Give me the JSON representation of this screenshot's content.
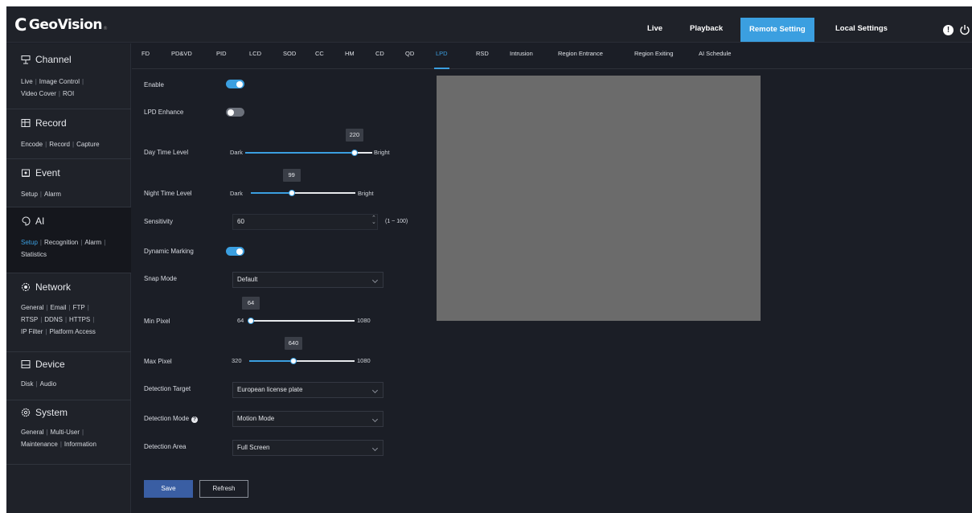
{
  "brand": {
    "name": "GeoVision"
  },
  "topnav": [
    {
      "label": "Live",
      "active": false
    },
    {
      "label": "Playback",
      "active": false
    },
    {
      "label": "Remote Setting",
      "active": true
    },
    {
      "label": "Local Settings",
      "active": false
    }
  ],
  "sidebar": {
    "channel": {
      "title": "Channel",
      "links": [
        "Live",
        "Image Control",
        "Video Cover",
        "ROI"
      ]
    },
    "record": {
      "title": "Record",
      "links": [
        "Encode",
        "Record",
        "Capture"
      ]
    },
    "event": {
      "title": "Event",
      "links": [
        "Setup",
        "Alarm"
      ]
    },
    "ai": {
      "title": "AI",
      "links": [
        "Setup",
        "Recognition",
        "Alarm",
        "Statistics"
      ],
      "active_link": "Setup"
    },
    "network": {
      "title": "Network",
      "links": [
        "General",
        "Email",
        "FTP",
        "RTSP",
        "DDNS",
        "HTTPS",
        "IP Filter",
        "Platform Access"
      ]
    },
    "device": {
      "title": "Device",
      "links": [
        "Disk",
        "Audio"
      ]
    },
    "system": {
      "title": "System",
      "links": [
        "General",
        "Multi-User",
        "Maintenance",
        "Information"
      ]
    }
  },
  "tabs": [
    "FD",
    "PD&VD",
    "PID",
    "LCD",
    "SOD",
    "CC",
    "HM",
    "CD",
    "QD",
    "LPD",
    "RSD",
    "Intrusion",
    "Region Entrance",
    "Region Exiting",
    "AI Schedule"
  ],
  "active_tab": "LPD",
  "form": {
    "enable": {
      "label": "Enable",
      "on": true
    },
    "lpd_enhance": {
      "label": "LPD Enhance",
      "on": false
    },
    "day_time_level": {
      "label": "Day Time Level",
      "min_label": "Dark",
      "max_label": "Bright",
      "value": 220,
      "value_text": "220",
      "fraction": 0.86
    },
    "night_time_level": {
      "label": "Night Time Level",
      "min_label": "Dark",
      "max_label": "Bright",
      "value": 99,
      "value_text": "99",
      "fraction": 0.39
    },
    "sensitivity": {
      "label": "Sensitivity",
      "value": "60",
      "range_hint": "(1 ~ 100)"
    },
    "dynamic_marking": {
      "label": "Dynamic Marking",
      "on": true
    },
    "snap_mode": {
      "label": "Snap Mode",
      "value": "Default"
    },
    "min_pixel": {
      "label": "Min Pixel",
      "min_label": "64",
      "max_label": "1080",
      "value": 64,
      "value_text": "64",
      "fraction": 0.0
    },
    "max_pixel": {
      "label": "Max Pixel",
      "min_label": "320",
      "max_label": "1080",
      "value": 640,
      "value_text": "640",
      "fraction": 0.42
    },
    "detection_target": {
      "label": "Detection Target",
      "value": "European license plate"
    },
    "detection_mode": {
      "label": "Detection Mode",
      "value": "Motion Mode"
    },
    "detection_area": {
      "label": "Detection Area",
      "value": "Full Screen"
    }
  },
  "buttons": {
    "save": "Save",
    "refresh": "Refresh"
  },
  "colors": {
    "accent": "#3b9fe0",
    "save": "#3a5ea3",
    "background": "#1b1e26",
    "preview": "#6b6b6b"
  }
}
